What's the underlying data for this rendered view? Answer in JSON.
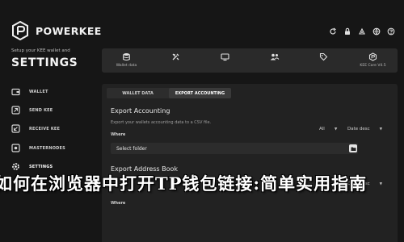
{
  "brand": {
    "name": "POWERKEE",
    "tagline": "Setup your KEE wallet and",
    "section_title": "SETTINGS"
  },
  "sidebar": {
    "items": [
      {
        "label": "WALLET",
        "icon": "wallet-icon"
      },
      {
        "label": "SEND KEE",
        "icon": "send-icon"
      },
      {
        "label": "RECEIVE KEE",
        "icon": "receive-icon"
      },
      {
        "label": "MASTERNODES",
        "icon": "masternodes-icon"
      },
      {
        "label": "SETTINGS",
        "icon": "settings-icon",
        "active": true
      }
    ]
  },
  "top_icons": [
    "refresh-icon",
    "lock-icon",
    "sync-icon",
    "network-icon",
    "info-icon"
  ],
  "tabs": [
    {
      "label": "Wallet data",
      "icon": "database-icon"
    },
    {
      "label": "",
      "icon": "tools-icon"
    },
    {
      "label": "",
      "icon": "display-icon"
    },
    {
      "label": "",
      "icon": "people-icon"
    },
    {
      "label": "",
      "icon": "tag-icon"
    },
    {
      "label": "KEE Core V4.5",
      "icon": "kee-core-icon"
    }
  ],
  "subtabs": [
    {
      "label": "WALLET DATA",
      "active": false
    },
    {
      "label": "EXPORT ACCOUNTING",
      "active": true
    }
  ],
  "export_accounting": {
    "title": "Export Accounting",
    "description": "Export your wallets accounting data to a CSV file.",
    "where_label": "Where",
    "filter_all": "All",
    "sort": "Date desc",
    "folder_value": "Select folder"
  },
  "export_address_book": {
    "title": "Export Address Book",
    "where_label": "Where",
    "filter_all": "All",
    "sort": "Date desc"
  },
  "overlay_text": "如何在浏览器中打开TP钱包链接:简单实用指南",
  "colors": {
    "background": "#161616",
    "panel": "#222222",
    "tabbar": "#2a2a2a",
    "text_primary": "#e6e6e6"
  }
}
